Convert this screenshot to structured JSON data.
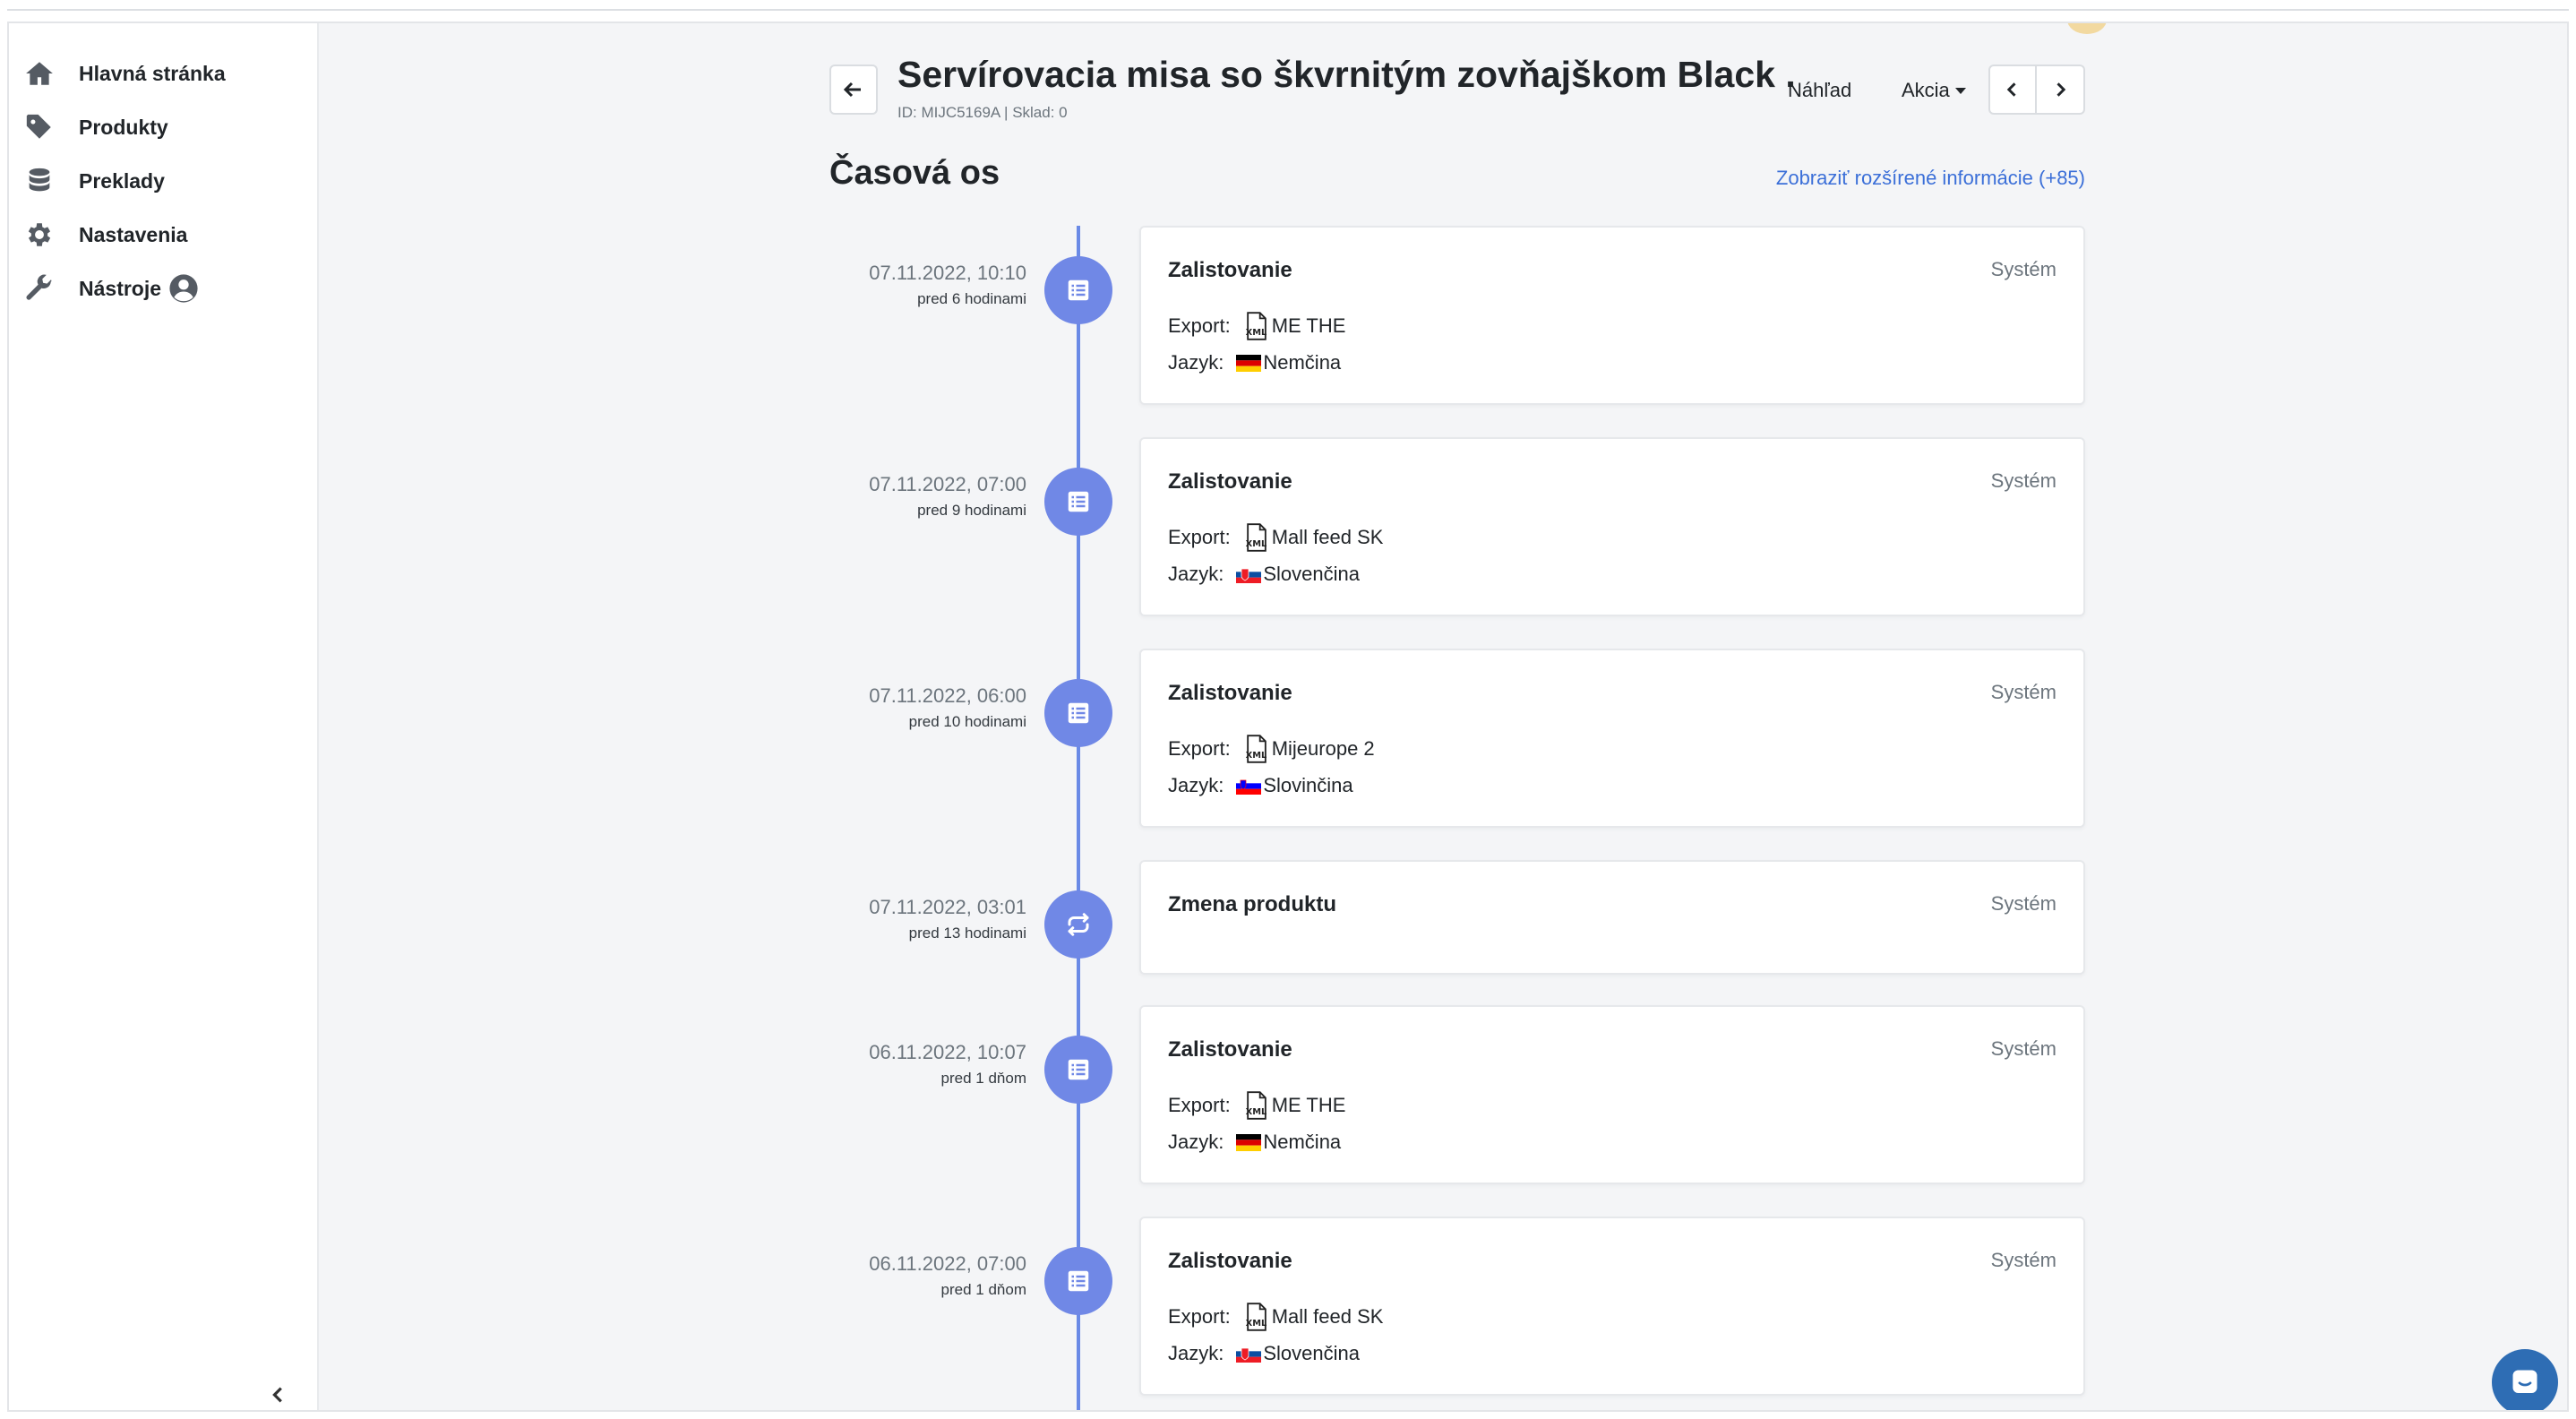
{
  "sidebar": {
    "items": [
      {
        "label": "Hlavná stránka",
        "icon": "home-icon"
      },
      {
        "label": "Produkty",
        "icon": "tag-icon"
      },
      {
        "label": "Preklady",
        "icon": "database-icon"
      },
      {
        "label": "Nastavenia",
        "icon": "gear-icon"
      },
      {
        "label": "Nástroje",
        "icon": "wrench-icon"
      }
    ]
  },
  "header": {
    "title": "Servírovacia misa so škvrnitým zovňajškom Black ...",
    "subline": "ID: MIJC5169A | Sklad: 0",
    "preview_label": "Náhľad",
    "actions_label": "Akcia"
  },
  "timeline": {
    "title": "Časová os",
    "more_info": "Zobraziť rozšírené informácie (+85)",
    "events": [
      {
        "date": "07.11.2022, 10:10",
        "relative": "pred 6 hodinami",
        "title": "Zalistovanie",
        "actor": "Systém",
        "export_label": "Export:",
        "export": "ME THE",
        "lang_label": "Jazyk:",
        "lang": "Nemčina",
        "flag": "de"
      },
      {
        "date": "07.11.2022, 07:00",
        "relative": "pred 9 hodinami",
        "title": "Zalistovanie",
        "actor": "Systém",
        "export_label": "Export:",
        "export": "Mall feed SK",
        "lang_label": "Jazyk:",
        "lang": "Slovenčina",
        "flag": "sk"
      },
      {
        "date": "07.11.2022, 06:00",
        "relative": "pred 10 hodinami",
        "title": "Zalistovanie",
        "actor": "Systém",
        "export_label": "Export:",
        "export": "Mijeurope 2",
        "lang_label": "Jazyk:",
        "lang": "Slovinčina",
        "flag": "si"
      },
      {
        "date": "07.11.2022, 03:01",
        "relative": "pred 13 hodinami",
        "title": "Zmena produktu",
        "actor": "Systém"
      },
      {
        "date": "06.11.2022, 10:07",
        "relative": "pred 1 dňom",
        "title": "Zalistovanie",
        "actor": "Systém",
        "export_label": "Export:",
        "export": "ME THE",
        "lang_label": "Jazyk:",
        "lang": "Nemčina",
        "flag": "de"
      },
      {
        "date": "06.11.2022, 07:00",
        "relative": "pred 1 dňom",
        "title": "Zalistovanie",
        "actor": "Systém",
        "export_label": "Export:",
        "export": "Mall feed SK",
        "lang_label": "Jazyk:",
        "lang": "Slovenčina",
        "flag": "sk"
      }
    ]
  },
  "colors": {
    "accent": "#7088e6",
    "timeline_line": "#6a8ae6",
    "link": "#3b6fd8",
    "chat": "#2e6db4"
  }
}
